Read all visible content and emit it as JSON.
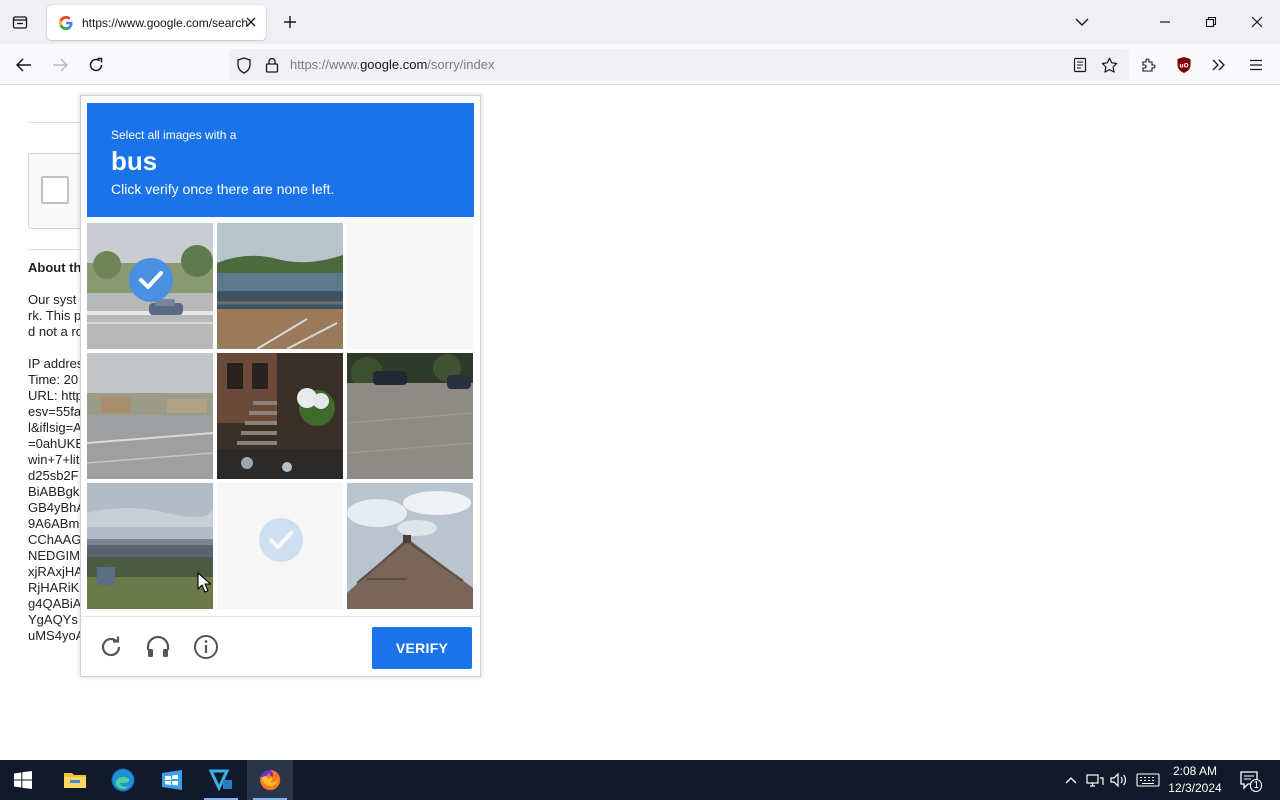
{
  "browser": {
    "tab": {
      "title": "https://www.google.com/search",
      "favicon": "G"
    },
    "url": {
      "prefix": "https://www.",
      "domain": "google.com",
      "path": "/sorry/index"
    }
  },
  "page_background": {
    "heading": "About th",
    "lines": [
      "Our syst",
      "rk. This p",
      "d not a ro",
      "",
      "IP addres",
      "Time: 20",
      "URL: http",
      "esv=55fa",
      "l&iflsig=A",
      "=0ahUKE",
      "win+7+lit",
      "d25sb2F",
      "BiABBgk",
      "GB4yBhA",
      "9A6ABm",
      "CChAAG",
      "NEDGIM",
      "xjRAxjHA",
      "RjHARiK",
      "g4QABiA",
      "YgAQYs",
      "uMS4yoA"
    ]
  },
  "captcha": {
    "instruction_line1": "Select all images with a",
    "target": "bus",
    "instruction_line3": "Click verify once there are none left.",
    "verify_label": "VERIFY",
    "tiles": [
      {
        "scene": "street-car",
        "selected": true,
        "state": "normal"
      },
      {
        "scene": "harbor",
        "selected": false,
        "state": "normal"
      },
      {
        "scene": "none",
        "selected": false,
        "state": "loading"
      },
      {
        "scene": "road",
        "selected": false,
        "state": "normal"
      },
      {
        "scene": "stairs",
        "selected": false,
        "state": "normal"
      },
      {
        "scene": "parking",
        "selected": false,
        "state": "normal"
      },
      {
        "scene": "bridge",
        "selected": false,
        "state": "normal"
      },
      {
        "scene": "none",
        "selected": true,
        "state": "fading"
      },
      {
        "scene": "roof",
        "selected": false,
        "state": "normal"
      }
    ]
  },
  "taskbar": {
    "time": "2:08 AM",
    "date": "12/3/2024",
    "notification_count": "1"
  },
  "colors": {
    "captcha_blue": "#1a73e8",
    "check_blue": "#4a90e2",
    "taskbar": "#101a2a"
  }
}
